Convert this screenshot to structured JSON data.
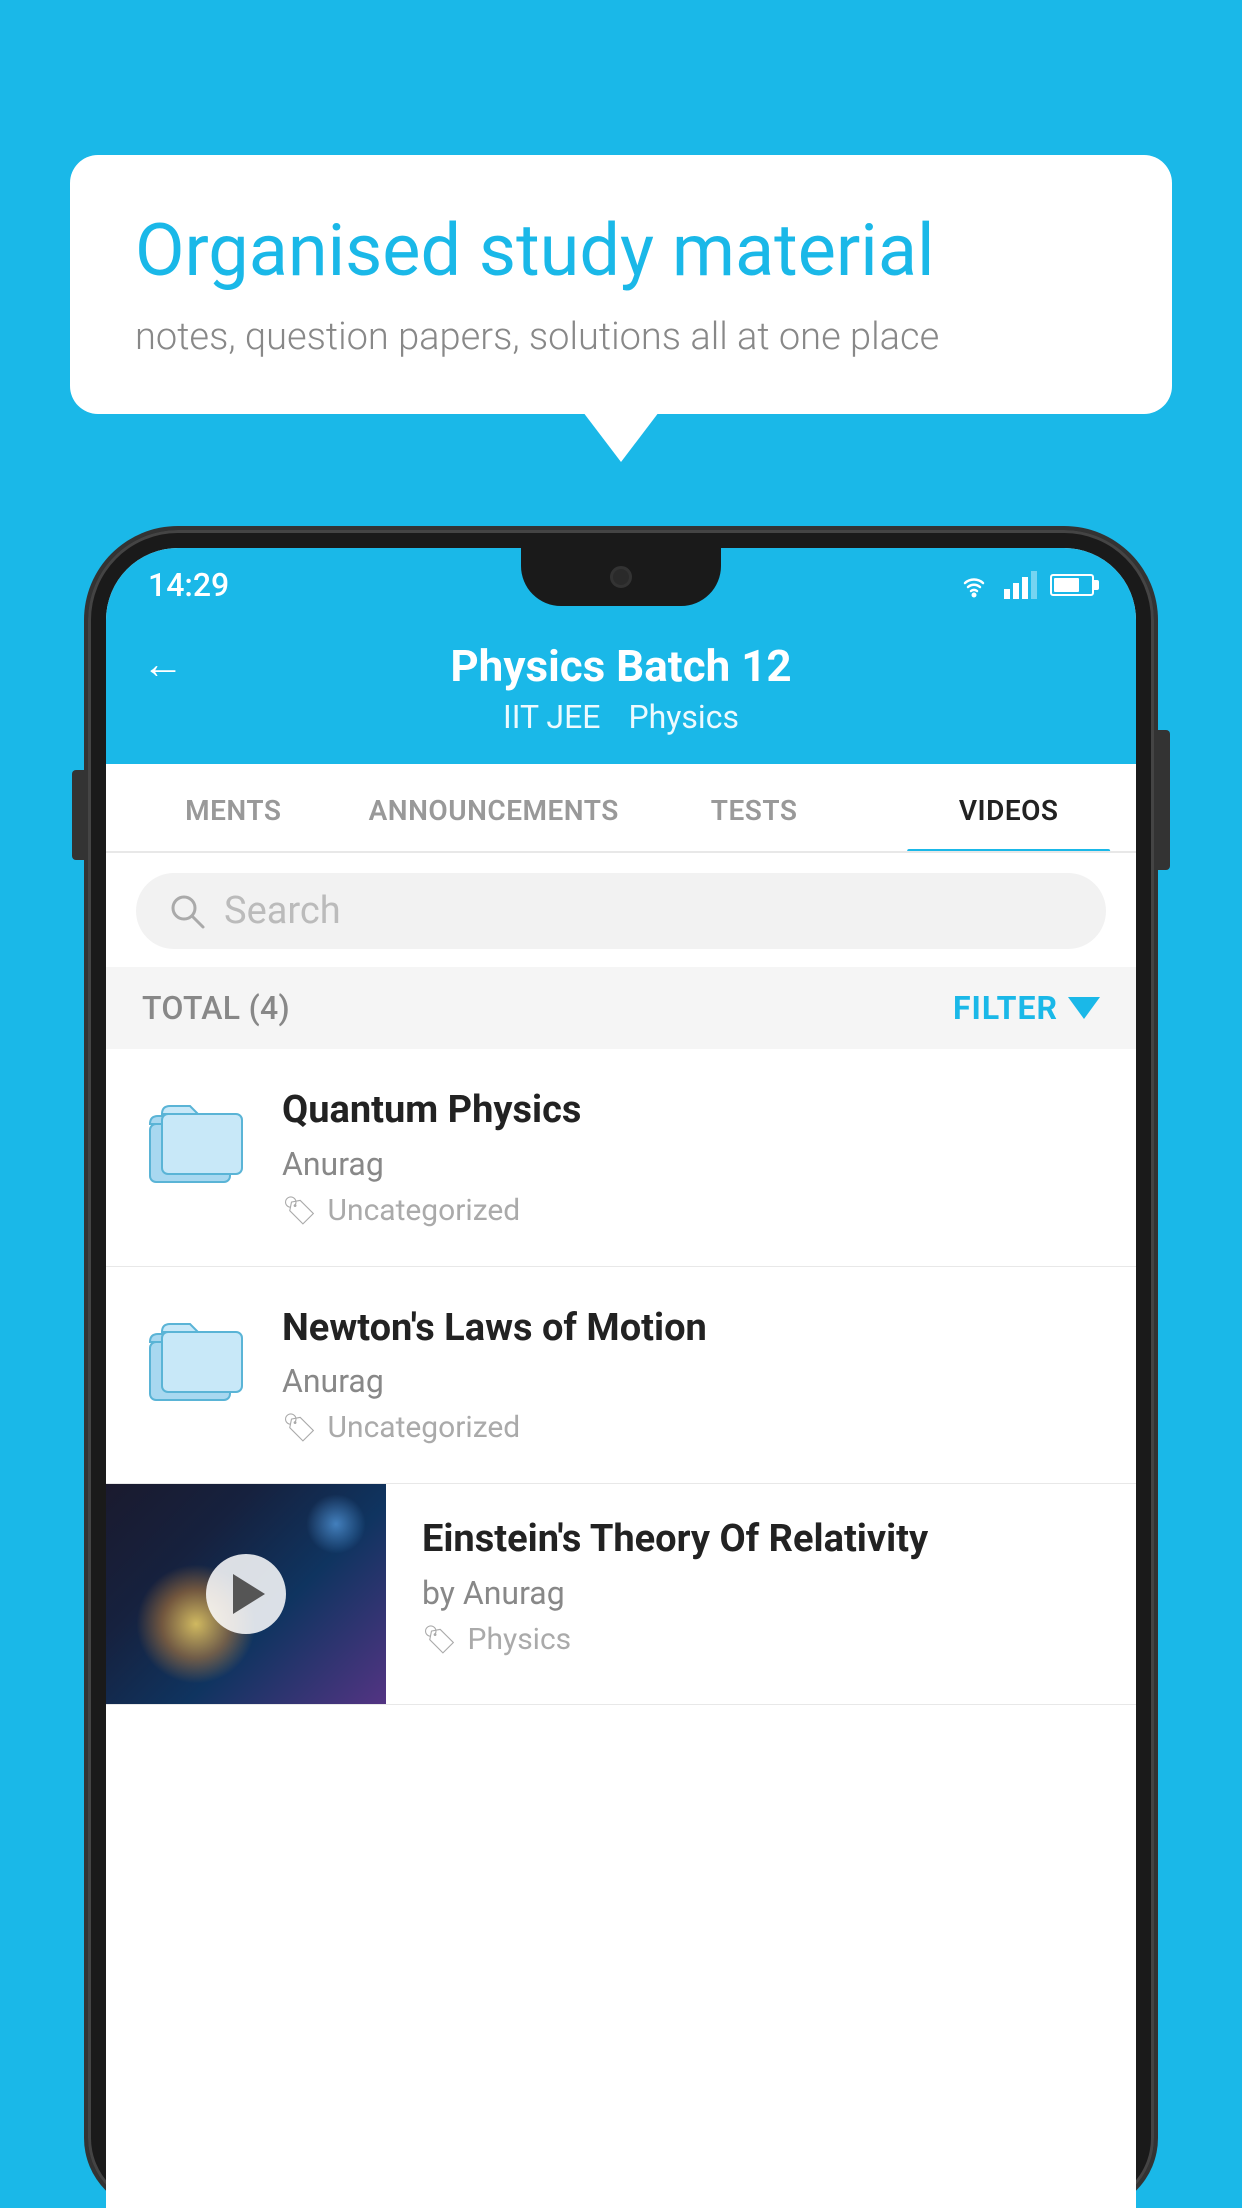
{
  "background_color": "#1ab8e8",
  "speech_bubble": {
    "title": "Organised study material",
    "subtitle": "notes, question papers, solutions all at one place"
  },
  "status_bar": {
    "time": "14:29",
    "wifi": "▼",
    "signal": "▲",
    "battery": "70"
  },
  "header": {
    "back_label": "←",
    "title": "Physics Batch 12",
    "tag1": "IIT JEE",
    "tag2": "Physics"
  },
  "tabs": [
    {
      "label": "MENTS",
      "active": false
    },
    {
      "label": "ANNOUNCEMENTS",
      "active": false
    },
    {
      "label": "TESTS",
      "active": false
    },
    {
      "label": "VIDEOS",
      "active": true
    }
  ],
  "search": {
    "placeholder": "Search"
  },
  "filter": {
    "total_label": "TOTAL (4)",
    "filter_label": "FILTER"
  },
  "videos": [
    {
      "title": "Quantum Physics",
      "author": "Anurag",
      "tag": "Uncategorized",
      "has_thumbnail": false,
      "thumbnail_type": "folder"
    },
    {
      "title": "Newton's Laws of Motion",
      "author": "Anurag",
      "tag": "Uncategorized",
      "has_thumbnail": false,
      "thumbnail_type": "folder"
    },
    {
      "title": "Einstein's Theory Of Relativity",
      "author": "by Anurag",
      "tag": "Physics",
      "has_thumbnail": true,
      "thumbnail_type": "video"
    }
  ]
}
